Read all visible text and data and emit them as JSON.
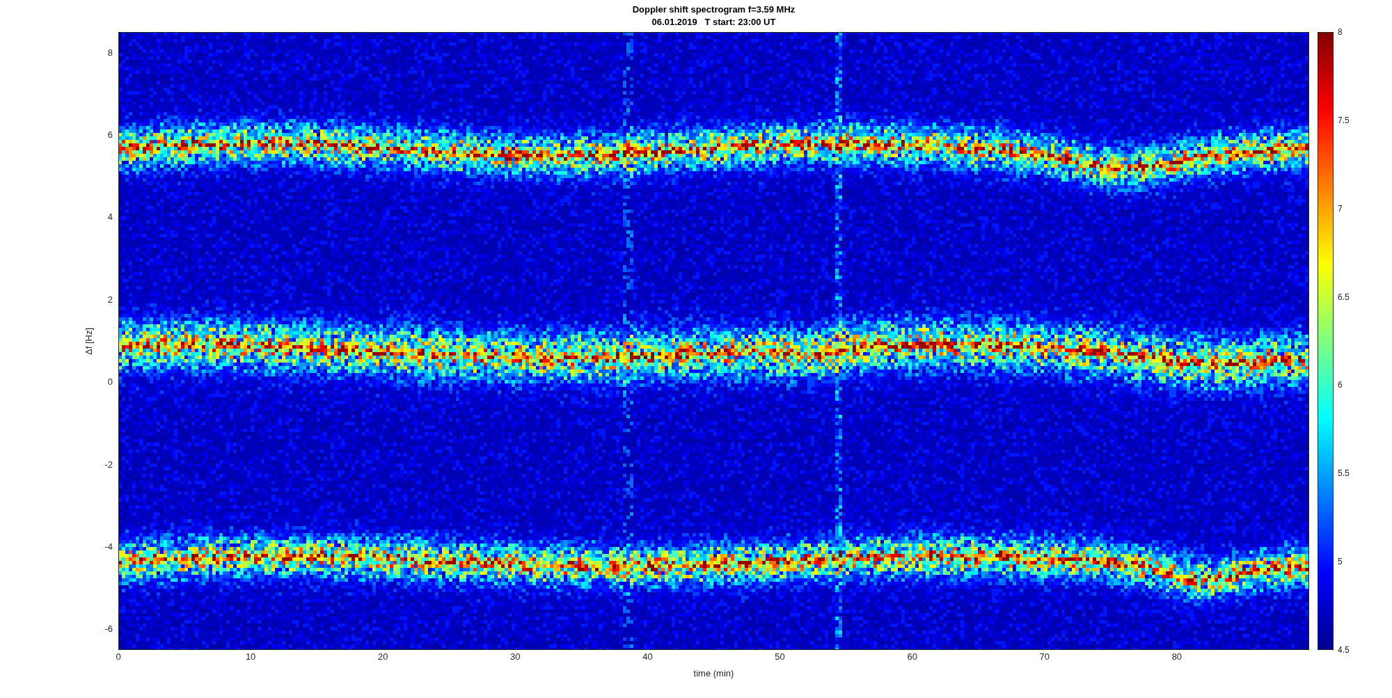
{
  "figure": {
    "title": "Doppler shift spectrogram f=3.59 MHz",
    "subtitle": "06.01.2019   T start: 23:00 UT",
    "xlabel": "time (min)",
    "ylabel": "Δf [Hz]",
    "x_ticks": [
      "0",
      "10",
      "20",
      "30",
      "40",
      "50",
      "60",
      "70",
      "80"
    ],
    "y_ticks": [
      "8",
      "6",
      "4",
      "2",
      "0",
      "-2",
      "-4",
      "-6"
    ],
    "colorbar_ticks": [
      "8",
      "7.5",
      "7",
      "6.5",
      "6",
      "5.5",
      "5",
      "4.5"
    ]
  }
}
